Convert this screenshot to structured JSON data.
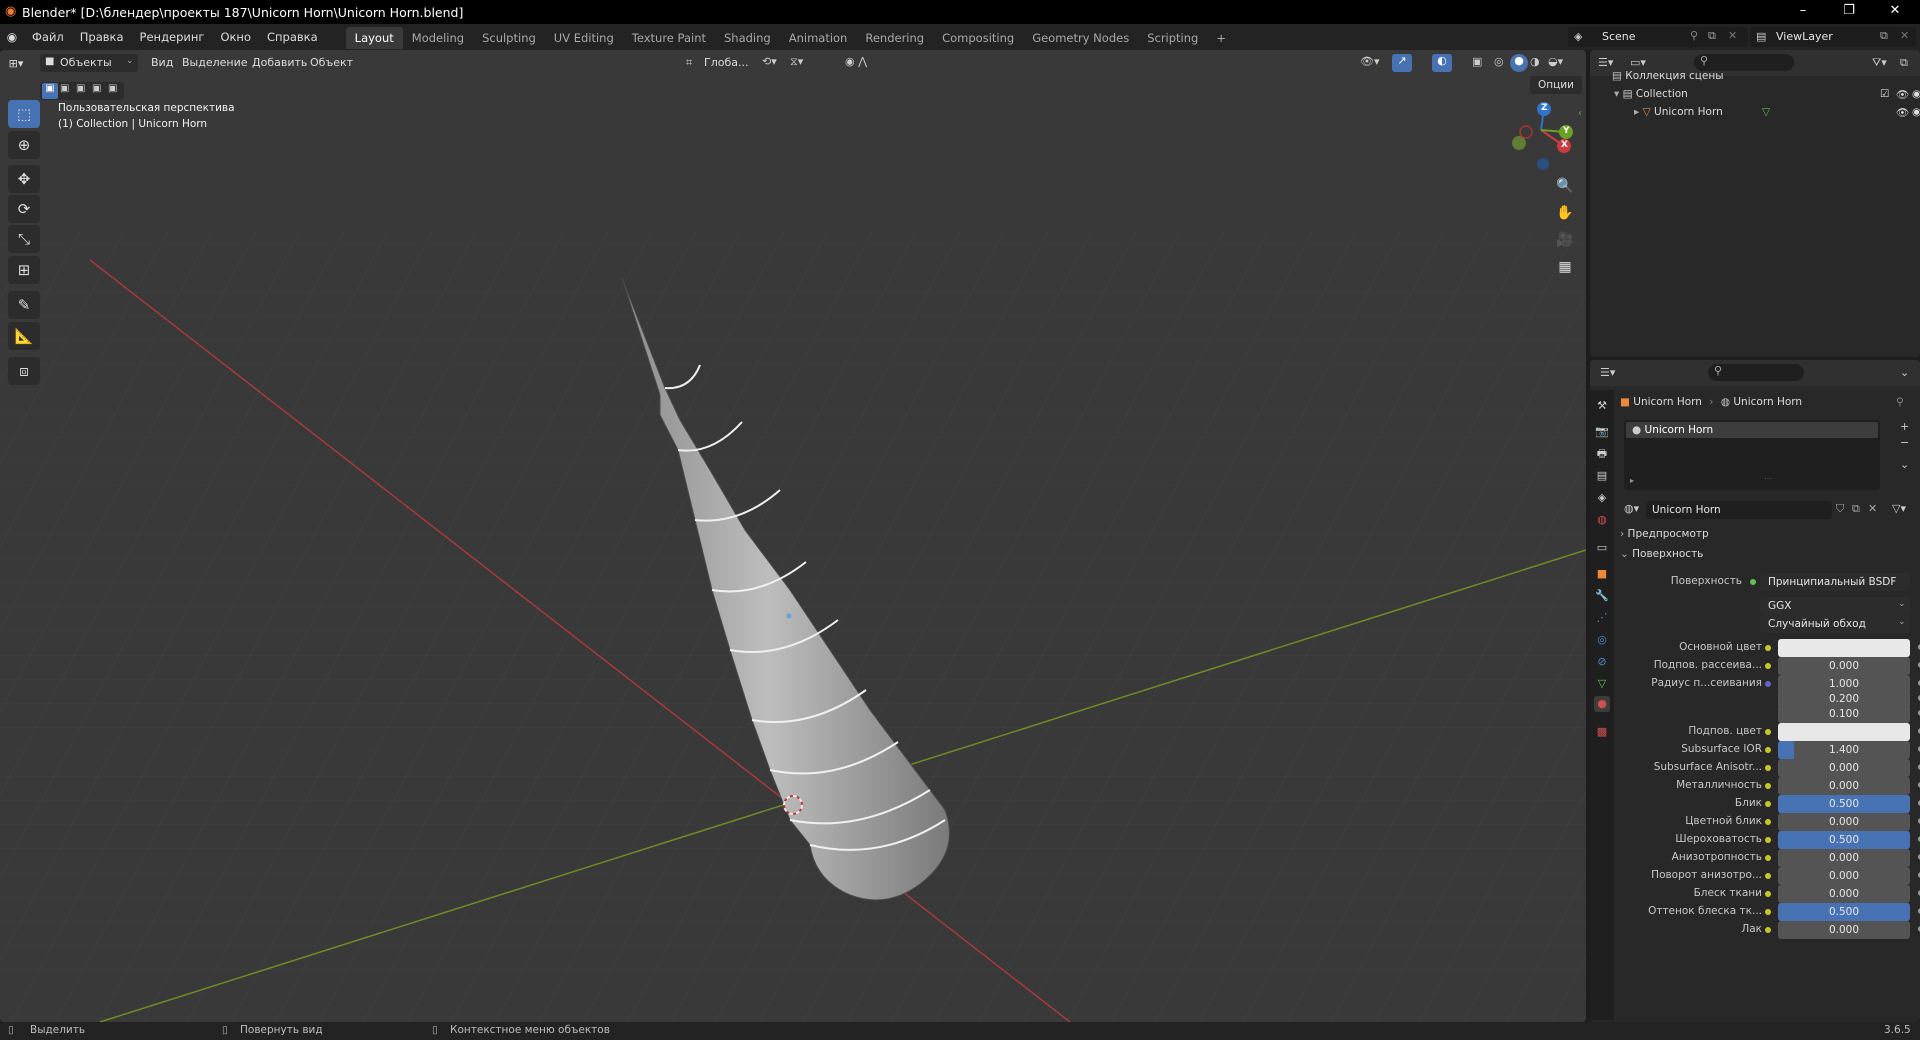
{
  "window": {
    "title": "Blender* [D:\\блендер\\проекты 187\\Unicorn Horn\\Unicorn Horn.blend]",
    "minimize": "–",
    "maximize": "❐",
    "close": "✕"
  },
  "menu": [
    "Файл",
    "Правка",
    "Рендеринг",
    "Окно",
    "Справка"
  ],
  "workspaces": [
    "Layout",
    "Modeling",
    "Sculpting",
    "UV Editing",
    "Texture Paint",
    "Shading",
    "Animation",
    "Rendering",
    "Compositing",
    "Geometry Nodes",
    "Scripting",
    "+"
  ],
  "scene": {
    "label": "Scene",
    "view_layer": "ViewLayer"
  },
  "viewport_header": {
    "mode": "Объекты",
    "menus": [
      "Вид",
      "Выделение",
      "Добавить",
      "Объект"
    ],
    "transform_orientation": "Глоба...",
    "options": "Опции"
  },
  "viewport_overlay": {
    "view_name": "Пользовательская перспектива",
    "collection_info": "(1) Collection | Unicorn Horn"
  },
  "gizmo": {
    "x": "X",
    "y": "Y",
    "z": "Z"
  },
  "outliner": {
    "root": "Коллекция сцены",
    "collection": "Collection",
    "object": "Unicorn Horn"
  },
  "properties": {
    "breadcrumb_object": "Unicorn Horn",
    "breadcrumb_material": "Unicorn Horn",
    "slot": "Unicorn Horn",
    "material_name": "Unicorn Horn",
    "panel_preview": "Предпросмотр",
    "panel_surface": "Поверхность",
    "surface_label": "Поверхность",
    "surface_shader": "Принципиальный BSDF",
    "distribution": "GGX",
    "subsurface_method": "Случайный обход",
    "rows": [
      {
        "label": "Основной цвет",
        "value": "",
        "kind": "color"
      },
      {
        "label": "Подпов. рассеива...",
        "value": "0.000",
        "fill": 0
      },
      {
        "label": "Радиус п...сеивания",
        "value": "1.000",
        "fill": 0,
        "dot": "blue"
      },
      {
        "label": "",
        "value": "0.200",
        "fill": 0
      },
      {
        "label": "",
        "value": "0.100",
        "fill": 0
      },
      {
        "label": "Подпов. цвет",
        "value": "",
        "kind": "color"
      },
      {
        "label": "Subsurface IOR",
        "value": "1.400",
        "fill": 0.12
      },
      {
        "label": "Subsurface Anisotr...",
        "value": "0.000",
        "fill": 0
      },
      {
        "label": "Металличность",
        "value": "0.000",
        "fill": 0
      },
      {
        "label": "Блик",
        "value": "0.500",
        "fill": 1
      },
      {
        "label": "Цветной блик",
        "value": "0.000",
        "fill": 0
      },
      {
        "label": "Шероховатость",
        "value": "0.500",
        "fill": 1
      },
      {
        "label": "Анизотропность",
        "value": "0.000",
        "fill": 0
      },
      {
        "label": "Поворот анизотро...",
        "value": "0.000",
        "fill": 0
      },
      {
        "label": "Блеск ткани",
        "value": "0.000",
        "fill": 0
      },
      {
        "label": "Оттенок блеска тк...",
        "value": "0.500",
        "fill": 1
      },
      {
        "label": "Лак",
        "value": "0.000",
        "fill": 0
      }
    ]
  },
  "statusbar": {
    "select": "Выделить",
    "rotate": "Повернуть вид",
    "context": "Контекстное меню объектов",
    "version": "3.6.5"
  },
  "colors": {
    "accent": "#4772b3",
    "viewport_bg": "#393939",
    "panel_bg": "#282828",
    "x_axis": "#a83a3d",
    "y_axis": "#6e8c26"
  }
}
